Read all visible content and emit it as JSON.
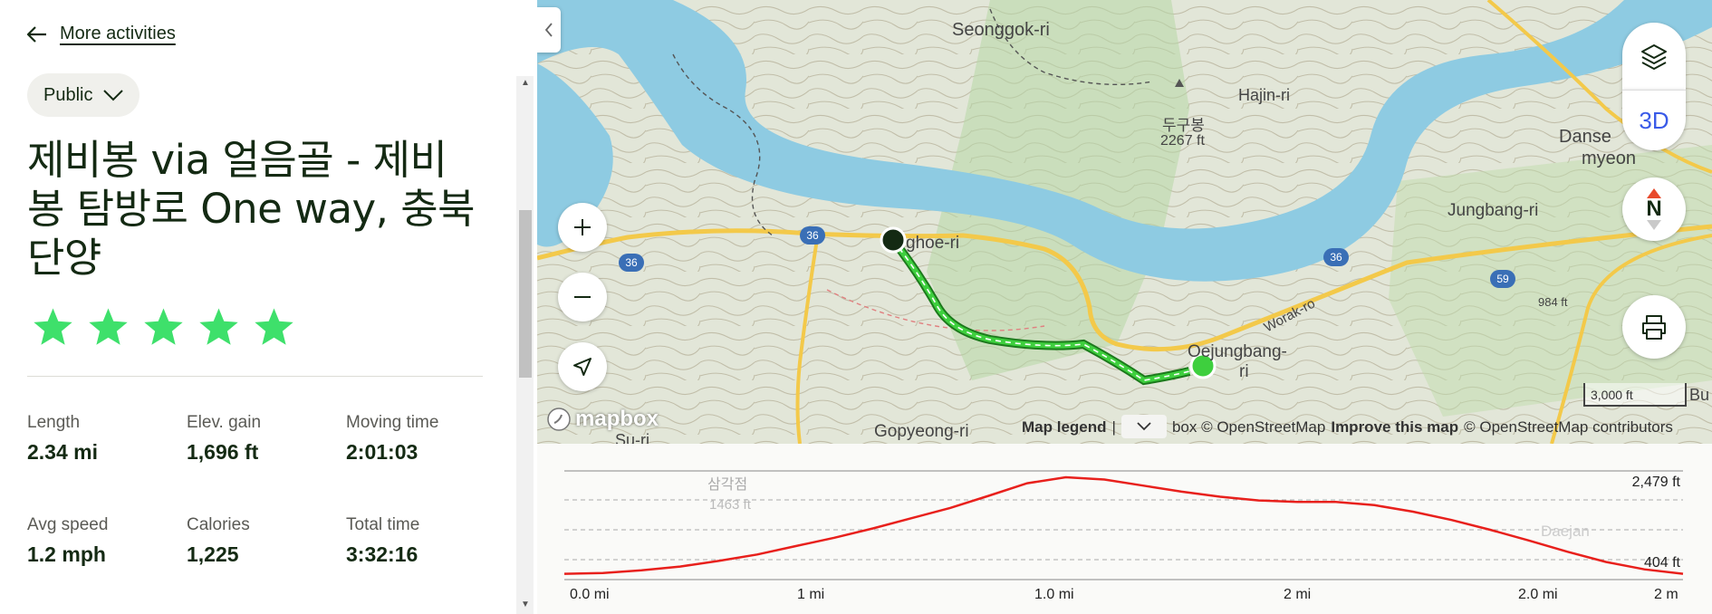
{
  "nav": {
    "back_label": "More activities"
  },
  "visibility": {
    "label": "Public"
  },
  "activity": {
    "title": "제비봉 via 얼음골 - 제비봉 탐방로 One way, 충북 단양",
    "rating": 5
  },
  "stats": [
    {
      "label": "Length",
      "value": "2.34 mi"
    },
    {
      "label": "Elev. gain",
      "value": "1,696 ft"
    },
    {
      "label": "Moving time",
      "value": "2:01:03"
    },
    {
      "label": "Avg speed",
      "value": "1.2 mph"
    },
    {
      "label": "Calories",
      "value": "1,225"
    },
    {
      "label": "Total time",
      "value": "3:32:16"
    }
  ],
  "map": {
    "labels": {
      "seonggok": "Seonggok-ri",
      "hajin": "Hajin-ri",
      "dugubong": "두구봉",
      "dugubong_elev": "2267 ft",
      "danse": "Danse",
      "myeon": "myeon",
      "jungbang": "Jungbang-ri",
      "hoe": "ghoe-ri",
      "oejungbang": "Oejungbang-",
      "ri": "ri",
      "gopyeong": "Gopyeong-ri",
      "suri": "Su-ri",
      "woraro": "Worak-ro",
      "peak984": "984 ft",
      "bu": "Bu",
      "r36a": "36",
      "r36b": "36",
      "r36c": "36",
      "r59": "59"
    },
    "scale_label": "3,000 ft",
    "mapbox_logo": "mapbox",
    "three_d": "3D",
    "north": "N",
    "attribution": {
      "legend": "Map legend",
      "sep": "|",
      "mapbox": "box © OpenStreetMap",
      "improve": "Improve this map",
      "osm": "© OpenStreetMap contributors"
    }
  },
  "elevation": {
    "max_label": "2,479 ft",
    "min_label": "404 ft",
    "x_ticks": [
      "0.0 mi",
      "1 mi",
      "1.0 mi",
      "2 mi",
      "2.0 mi",
      "2 m"
    ],
    "bg_labels": {
      "peak": "삼각점",
      "peak_elev": "1463 ft",
      "town": "Daejan"
    },
    "profile": [
      404,
      420,
      480,
      560,
      680,
      820,
      1000,
      1180,
      1380,
      1600,
      1820,
      2080,
      2350,
      2479,
      2430,
      2300,
      2170,
      2060,
      1980,
      1950,
      1950,
      1880,
      1740,
      1560,
      1350,
      1120,
      880,
      660,
      500,
      404
    ],
    "line_color": "#e8201c"
  },
  "colors": {
    "trail": "#3ecf3e",
    "water": "#8ecbe2",
    "road": "#f3c94a",
    "star": "#3ee06b"
  }
}
